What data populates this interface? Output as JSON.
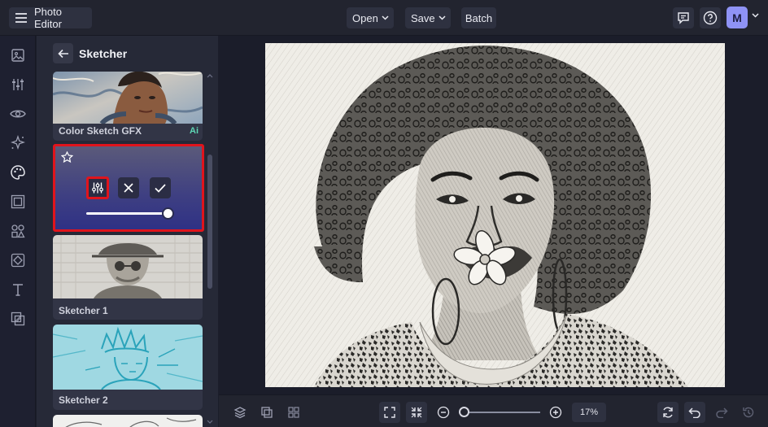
{
  "topbar": {
    "app_title": "Photo Editor",
    "open_label": "Open",
    "save_label": "Save",
    "batch_label": "Batch",
    "avatar_initial": "M"
  },
  "rail": {
    "icons": [
      "image-icon",
      "adjustments-icon",
      "eye-icon",
      "sparkle-icon",
      "palette-icon",
      "frame-icon",
      "shapes-icon",
      "texture-icon",
      "text-icon",
      "overlay-icon"
    ],
    "active": "palette-icon"
  },
  "panel": {
    "title": "Sketcher",
    "effects": [
      {
        "label": "Color Sketch GFX",
        "badge": "Ai"
      },
      {
        "label": ""
      },
      {
        "label": "Sketcher 1"
      },
      {
        "label": "Sketcher 2"
      }
    ],
    "intensity_fraction": 1.0
  },
  "bottombar": {
    "zoom_value": "17%",
    "zoom_fraction": 0.0
  },
  "colors": {
    "highlight": "#e0141c",
    "ai_badge": "#5ed6b4",
    "avatar_bg": "#8f93f5"
  }
}
